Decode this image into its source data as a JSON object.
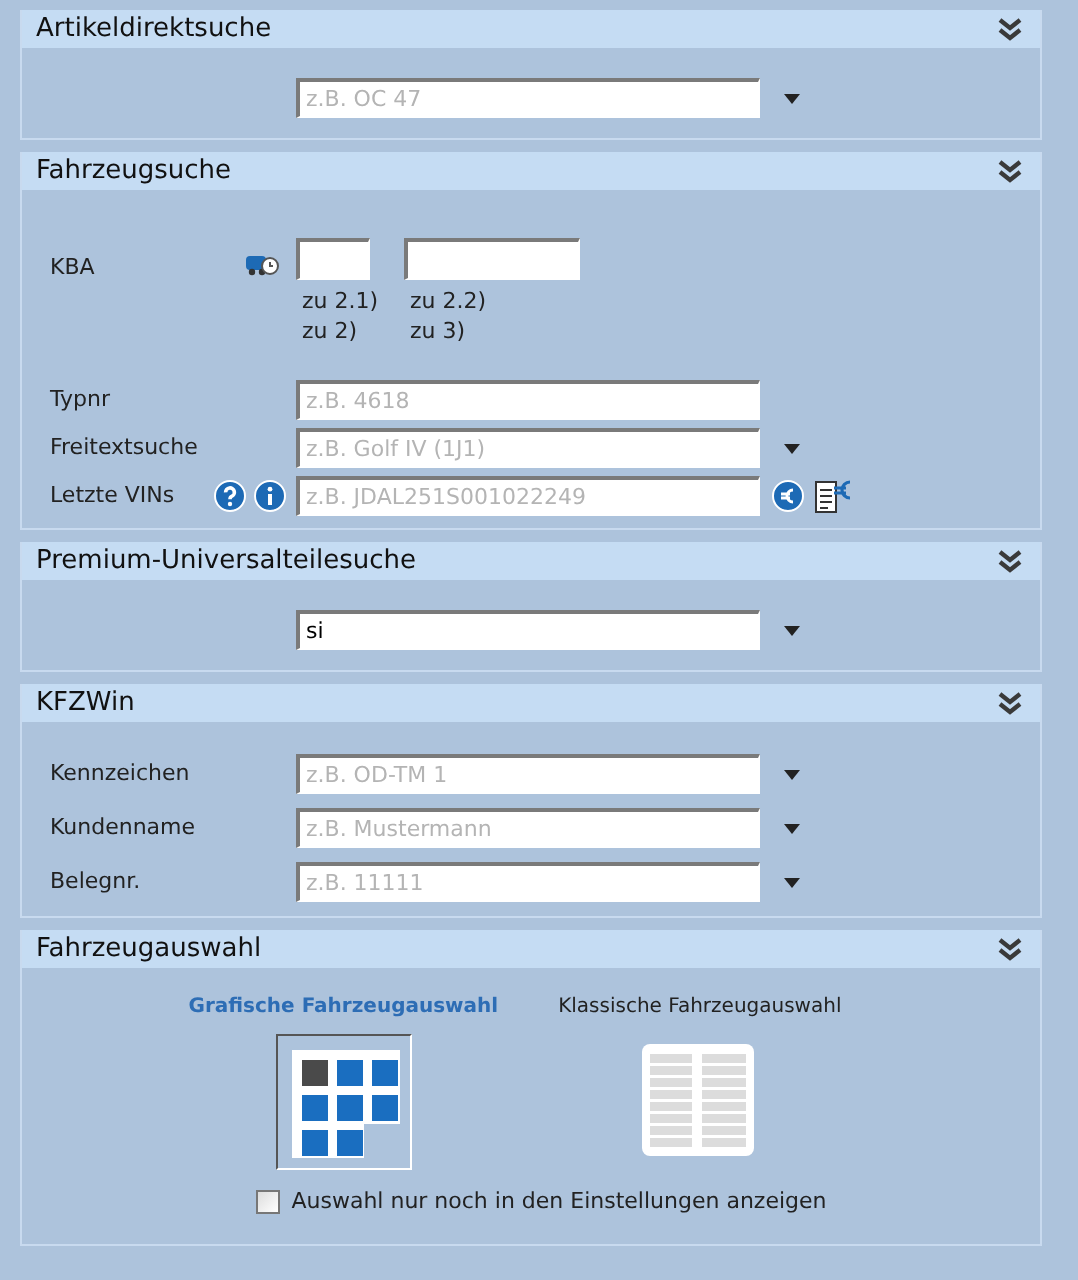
{
  "sections": [
    {
      "kind": "search",
      "title": "Artikeldirektsuche",
      "expanded": true,
      "rows": [
        {
          "placeholder": "z.B. OC 47",
          "dropdown": true
        }
      ]
    },
    {
      "kind": "vehicle",
      "title": "Fahrzeugsuche",
      "expanded": true,
      "kba": {
        "label": "KBA",
        "fields": [
          {
            "notes": [
              "zu 2.1)",
              "zu 2)"
            ]
          },
          {
            "notes": [
              "zu 2.2)",
              "zu 3)"
            ]
          }
        ]
      },
      "rows": [
        {
          "kind": "plain",
          "label": "Typnr",
          "placeholder": "z.B. 4618",
          "dropdown": false
        },
        {
          "kind": "plain",
          "label": "Freitextsuche",
          "placeholder": "z.B. Golf IV (1J1)",
          "dropdown": true
        },
        {
          "kind": "vin",
          "label": "Letzte VINs",
          "placeholder": "z.B. JDAL251S001022249",
          "dropdown": false
        }
      ]
    },
    {
      "kind": "search",
      "title": "Premium-Universalteilesuche",
      "expanded": true,
      "rows": [
        {
          "value": "si",
          "dropdown": true
        }
      ]
    },
    {
      "kind": "search",
      "title": "KFZWin",
      "expanded": true,
      "rows": [
        {
          "label": "Kennzeichen",
          "placeholder": "z.B. OD-TM 1",
          "dropdown": true
        },
        {
          "label": "Kundenname",
          "placeholder": "z.B. Mustermann",
          "dropdown": true
        },
        {
          "label": "Belegnr.",
          "placeholder": "z.B. 11111",
          "dropdown": true
        }
      ]
    },
    {
      "kind": "selection",
      "title": "Fahrzeugauswahl",
      "expanded": true,
      "options": [
        {
          "label": "Grafische Fahrzeugauswahl",
          "kind": "grid",
          "selected": true
        },
        {
          "label": "Klassische Fahrzeugauswahl",
          "kind": "list",
          "selected": false
        }
      ],
      "checkbox": {
        "label": "Auswahl nur noch in den Einstellungen anzeigen",
        "checked": false
      }
    }
  ]
}
